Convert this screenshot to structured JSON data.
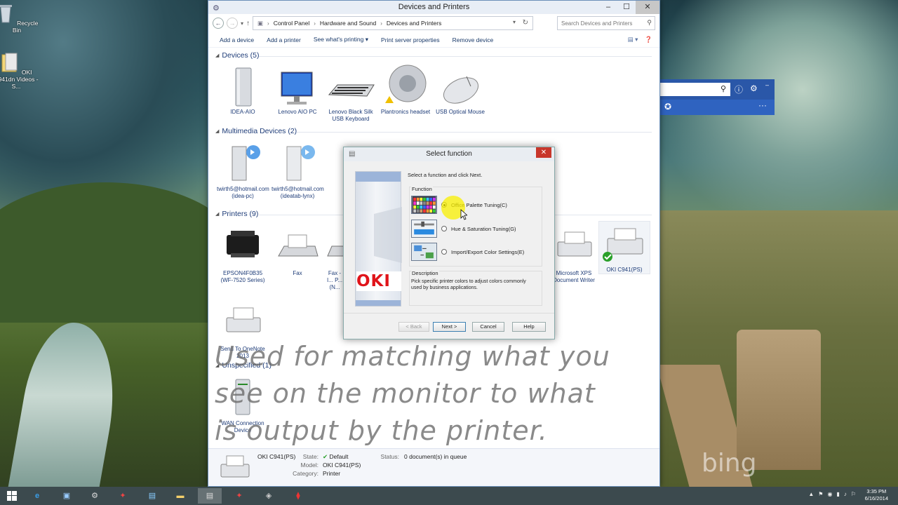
{
  "desktop": {
    "icons": [
      {
        "label": "Recycle Bin",
        "icon": "recycle-bin-icon"
      },
      {
        "label": "OKI C941dn Videos - S...",
        "icon": "folder-icon"
      }
    ],
    "bing_text": "bing"
  },
  "window": {
    "title": "Devices and Printers",
    "breadcrumb": [
      "Control Panel",
      "Hardware and Sound",
      "Devices and Printers"
    ],
    "search_placeholder": "Search Devices and Printers",
    "toolbar": {
      "add_device": "Add a device",
      "add_printer": "Add a printer",
      "see_printing": "See what's printing",
      "print_server": "Print server properties",
      "remove_device": "Remove device"
    },
    "groups": {
      "devices": "Devices (5)",
      "multimedia": "Multimedia Devices (2)",
      "printers": "Printers (9)",
      "unspecified": "Unspecified (1)"
    },
    "devices": [
      {
        "label": "IDEA-AIO"
      },
      {
        "label": "Lenovo AIO PC"
      },
      {
        "label": "Lenovo Black Silk USB Keyboard"
      },
      {
        "label": "Plantronics headset"
      },
      {
        "label": "USB Optical Mouse"
      }
    ],
    "multimedia": [
      {
        "label": "twirth5@hotmail.com (idea-pc)"
      },
      {
        "label": "twirth5@hotmail.com (ideatab-lynx)"
      }
    ],
    "printers": [
      {
        "label": "EPSON4F0B35 (WF-7520 Series)"
      },
      {
        "label": "Fax"
      },
      {
        "label": "Fax - I... P... (N..."
      },
      {
        "label": "Microsoft XPS Document Writer"
      },
      {
        "label": "OKI C941(PS)"
      },
      {
        "label": "Send To OneNote 2013"
      }
    ],
    "unspecified": [
      {
        "label": "WAN Connection Device"
      }
    ],
    "details": {
      "name": "OKI C941(PS)",
      "state_label": "State:",
      "state_value": "Default",
      "model_label": "Model:",
      "model_value": "OKI C941(PS)",
      "category_label": "Category:",
      "category_value": "Printer",
      "status_label": "Status:",
      "status_value": "0 document(s) in queue"
    }
  },
  "dialog": {
    "title": "Select function",
    "instruction": "Select a function and click Next.",
    "brand": "OKI",
    "function_caption": "Function",
    "options": [
      {
        "label": "Office Palette Tuning(C)",
        "selected": true
      },
      {
        "label": "Hue & Saturation Tuning(G)",
        "selected": false
      },
      {
        "label": "Import/Export Color Settings(E)",
        "selected": false
      }
    ],
    "description_caption": "Description",
    "description": "Pick specific printer colors to adjust colors commonly used by business applications.",
    "buttons": {
      "back": "< Back",
      "next": "Next >",
      "cancel": "Cancel",
      "help": "Help"
    }
  },
  "overlay_caption": [
    "Used for matching what you",
    "see on the monitor to what",
    "is output by the printer."
  ],
  "taskbar": {
    "time": "3:35 PM",
    "date": "6/16/2014"
  },
  "colors": {
    "accent_blue": "#2a57a8",
    "oki_red": "#e0141a",
    "link_blue": "#1e3c78"
  }
}
